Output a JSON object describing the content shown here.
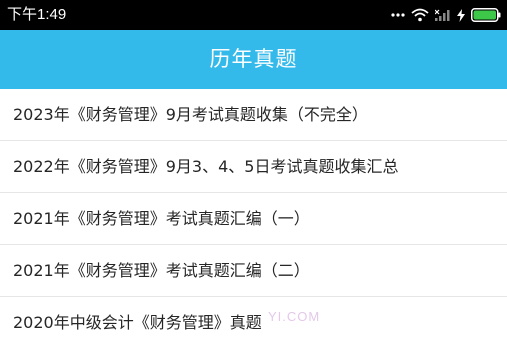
{
  "status_bar": {
    "time": "下午1:49",
    "icons": [
      "more-dots-icon",
      "wifi-icon",
      "signal-icon",
      "charging-bolt-icon",
      "battery-icon"
    ]
  },
  "header": {
    "title": "历年真题",
    "background_color": "#33baeb"
  },
  "list": {
    "items": [
      {
        "label": "2023年《财务管理》9月考试真题收集（不完全）"
      },
      {
        "label": "2022年《财务管理》9月3、4、5日考试真题收集汇总"
      },
      {
        "label": "2021年《财务管理》考试真题汇编（一）"
      },
      {
        "label": "2021年《财务管理》考试真题汇编（二）"
      },
      {
        "label": "2020年中级会计《财务管理》真题"
      }
    ]
  },
  "watermark": {
    "text": "YI.COM"
  }
}
